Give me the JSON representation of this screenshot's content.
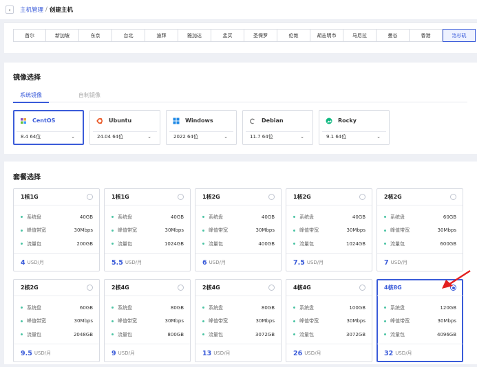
{
  "breadcrumb": {
    "back": "‹",
    "parent": "主机管理",
    "separator": "/",
    "current": "创建主机"
  },
  "regions": [
    {
      "label": "首尔",
      "active": false
    },
    {
      "label": "新加坡",
      "active": false
    },
    {
      "label": "东京",
      "active": false
    },
    {
      "label": "台北",
      "active": false
    },
    {
      "label": "迪拜",
      "active": false
    },
    {
      "label": "雅加达",
      "active": false
    },
    {
      "label": "孟买",
      "active": false
    },
    {
      "label": "圣保罗",
      "active": false
    },
    {
      "label": "伦敦",
      "active": false
    },
    {
      "label": "胡志明市",
      "active": false
    },
    {
      "label": "马尼拉",
      "active": false
    },
    {
      "label": "曼谷",
      "active": false
    },
    {
      "label": "香港",
      "active": false
    },
    {
      "label": "洛杉矶",
      "active": true
    }
  ],
  "image_section": {
    "title": "镜像选择",
    "tabs": [
      {
        "label": "系统镜像",
        "active": true
      },
      {
        "label": "自制镜像",
        "active": false
      }
    ],
    "os": [
      {
        "name": "CentOS",
        "version": "8.4 64位",
        "icon": "centos-icon",
        "color": "#8e4bb8",
        "active": true
      },
      {
        "name": "Ubuntu",
        "version": "24.04 64位",
        "icon": "ubuntu-icon",
        "color": "#e95420",
        "active": false
      },
      {
        "name": "Windows",
        "version": "2022 64位",
        "icon": "windows-icon",
        "color": "#1e88e5",
        "active": false
      },
      {
        "name": "Debian",
        "version": "11.7 64位",
        "icon": "debian-icon",
        "color": "#777777",
        "active": false
      },
      {
        "name": "Rocky",
        "version": "9.1 64位",
        "icon": "rocky-icon",
        "color": "#10b981",
        "active": false
      }
    ]
  },
  "package_section": {
    "title": "套餐选择",
    "spec_labels": {
      "disk": "系统盘",
      "bandwidth": "峰值带宽",
      "traffic": "流量包"
    },
    "currency": "USD/月",
    "packages": [
      {
        "name": "1核1G",
        "disk": "40GB",
        "bandwidth": "30Mbps",
        "traffic": "200GB",
        "price": "4",
        "selected": false
      },
      {
        "name": "1核1G",
        "disk": "40GB",
        "bandwidth": "30Mbps",
        "traffic": "1024GB",
        "price": "5.5",
        "selected": false
      },
      {
        "name": "1核2G",
        "disk": "40GB",
        "bandwidth": "30Mbps",
        "traffic": "400GB",
        "price": "6",
        "selected": false
      },
      {
        "name": "1核2G",
        "disk": "40GB",
        "bandwidth": "30Mbps",
        "traffic": "1024GB",
        "price": "7.5",
        "selected": false
      },
      {
        "name": "2核2G",
        "disk": "60GB",
        "bandwidth": "30Mbps",
        "traffic": "600GB",
        "price": "7",
        "selected": false
      },
      {
        "name": "2核2G",
        "disk": "60GB",
        "bandwidth": "30Mbps",
        "traffic": "2048GB",
        "price": "9.5",
        "selected": false
      },
      {
        "name": "2核4G",
        "disk": "80GB",
        "bandwidth": "30Mbps",
        "traffic": "800GB",
        "price": "9",
        "selected": false
      },
      {
        "name": "2核4G",
        "disk": "80GB",
        "bandwidth": "30Mbps",
        "traffic": "3072GB",
        "price": "13",
        "selected": false
      },
      {
        "name": "4核4G",
        "disk": "100GB",
        "bandwidth": "30Mbps",
        "traffic": "3072GB",
        "price": "26",
        "selected": false
      },
      {
        "name": "4核8G",
        "disk": "120GB",
        "bandwidth": "30Mbps",
        "traffic": "4096GB",
        "price": "32",
        "selected": true
      }
    ]
  },
  "colors": {
    "accent": "#3a5bd9",
    "dot": "#4cc4a4",
    "arrow": "#e32020"
  }
}
